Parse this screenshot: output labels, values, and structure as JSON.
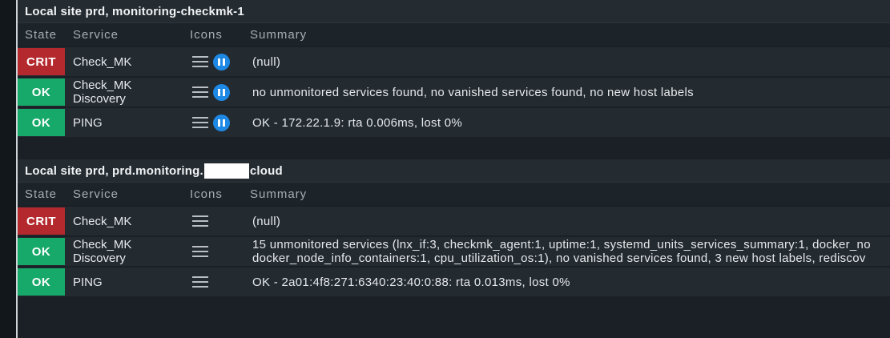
{
  "columns": {
    "state": "State",
    "service": "Service",
    "icons": "Icons",
    "summary": "Summary"
  },
  "hosts": [
    {
      "title": "Local site prd, monitoring-checkmk-1",
      "rows": [
        {
          "state": "CRIT",
          "service_line1": "Check_MK",
          "service_line2": "",
          "summary_line1": "(null)",
          "summary_line2": ""
        },
        {
          "state": "OK",
          "service_line1": "Check_MK",
          "service_line2": "Discovery",
          "summary_line1": "no unmonitored services found, no vanished services found, no new host labels",
          "summary_line2": ""
        },
        {
          "state": "OK",
          "service_line1": "PING",
          "service_line2": "",
          "summary_line1": "OK - 172.22.1.9: rta 0.006ms, lost 0%",
          "summary_line2": ""
        }
      ]
    },
    {
      "title_prefix": "Local site prd, prd.monitoring.",
      "title_suffix": "cloud",
      "rows": [
        {
          "state": "CRIT",
          "service_line1": "Check_MK",
          "service_line2": "",
          "summary_line1": "(null)",
          "summary_line2": ""
        },
        {
          "state": "OK",
          "service_line1": "Check_MK",
          "service_line2": "Discovery",
          "summary_line1": "15 unmonitored services (lnx_if:3, checkmk_agent:1, uptime:1, systemd_units_services_summary:1, docker_no",
          "summary_line2": "docker_node_info_containers:1, cpu_utilization_os:1), no vanished services found, 3 new host labels, rediscov"
        },
        {
          "state": "OK",
          "service_line1": "PING",
          "service_line2": "",
          "summary_line1": "OK - 2a01:4f8:271:6340:23:40:0:88: rta 0.013ms, lost 0%",
          "summary_line2": ""
        }
      ]
    }
  ],
  "colors": {
    "crit": "#b4292e",
    "ok": "#17a96a",
    "pause": "#1e88e5"
  },
  "icons": [
    "menu-icon",
    "pause-icon"
  ]
}
